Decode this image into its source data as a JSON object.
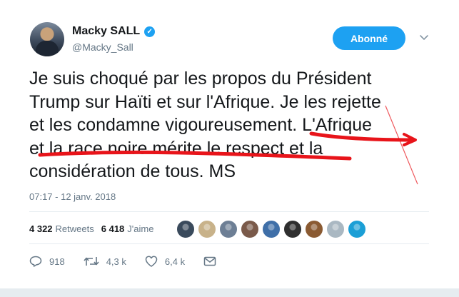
{
  "author": {
    "name": "Macky SALL",
    "handle": "@Macky_Sall"
  },
  "follow_button": {
    "label": "Abonné"
  },
  "tweet": {
    "lines": [
      "Je suis choqué par les propos du Président",
      "Trump sur Haïti et sur l'Afrique. Je les rejette",
      "et les condamne vigoureusement.  L'Afrique",
      "et la race noire mérite le respect et la",
      "considération de tous. MS"
    ],
    "timestamp": "07:17 - 12 janv. 2018"
  },
  "stats": {
    "retweets_value": "4 322",
    "retweets_label": "Retweets",
    "likes_value": "6 418",
    "likes_label": "J'aime"
  },
  "likers": [
    {
      "color": "#3a4a5c"
    },
    {
      "color": "#c8b28a"
    },
    {
      "color": "#6d7f95"
    },
    {
      "color": "#7a5a4a"
    },
    {
      "color": "#3f6fa8"
    },
    {
      "color": "#2f2f2f"
    },
    {
      "color": "#8a5a32"
    },
    {
      "color": "#aab8c2"
    },
    {
      "color": "#1b9fd6"
    }
  ],
  "actions": {
    "replies": "918",
    "retweets": "4,3 k",
    "likes": "6,4 k"
  },
  "colors": {
    "accent": "#1da1f2",
    "annotation": "#e8141a"
  }
}
